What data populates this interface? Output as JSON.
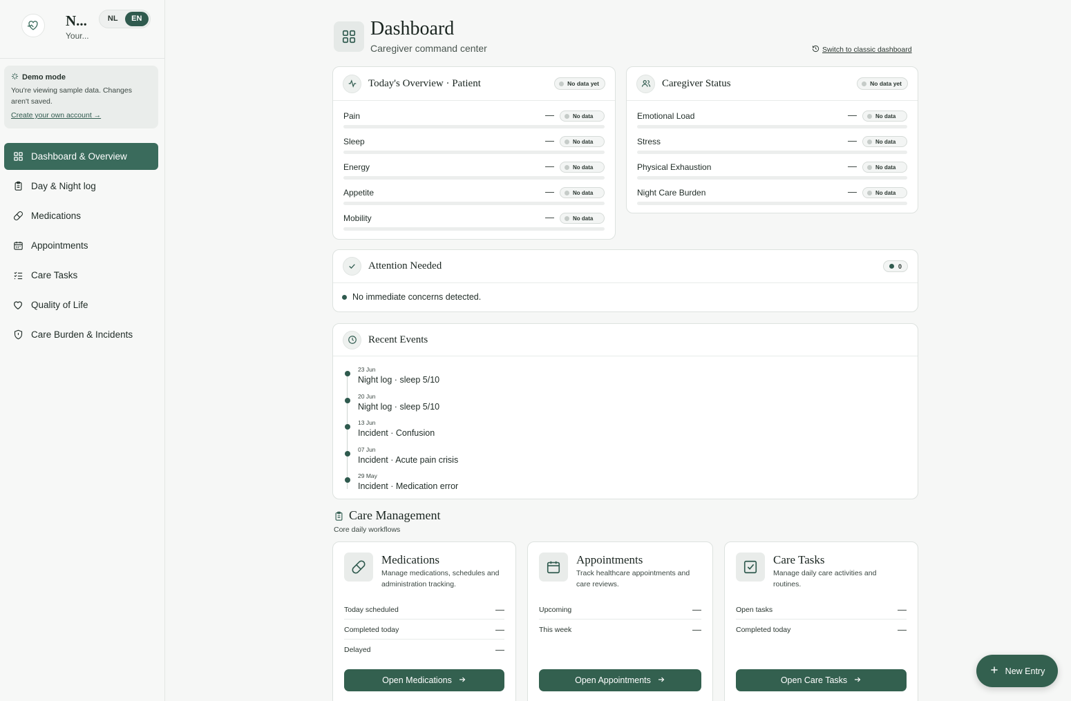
{
  "brand": {
    "title": "N...",
    "subtitle": "Your..."
  },
  "lang": {
    "nl": "NL",
    "en": "EN",
    "active": "EN"
  },
  "demo": {
    "title": "Demo mode",
    "text": "You're viewing sample data. Changes aren't saved.",
    "link": "Create your own account →"
  },
  "nav": [
    {
      "label": "Dashboard & Overview",
      "icon": "grid-icon",
      "active": true
    },
    {
      "label": "Day & Night log",
      "icon": "clipboard-icon"
    },
    {
      "label": "Medications",
      "icon": "pill-icon"
    },
    {
      "label": "Appointments",
      "icon": "calendar-icon"
    },
    {
      "label": "Care Tasks",
      "icon": "checklist-icon"
    },
    {
      "label": "Quality of Life",
      "icon": "heart-icon"
    },
    {
      "label": "Care Burden & Incidents",
      "icon": "shield-icon"
    }
  ],
  "header": {
    "title": "Dashboard",
    "subtitle": "Caregiver command center",
    "switch_link": "Switch to classic dashboard"
  },
  "overview": {
    "title": "Today's Overview · Patient",
    "badge": "No data yet",
    "metrics": [
      {
        "label": "Pain",
        "value": "—",
        "status": "No data"
      },
      {
        "label": "Sleep",
        "value": "—",
        "status": "No data"
      },
      {
        "label": "Energy",
        "value": "—",
        "status": "No data"
      },
      {
        "label": "Appetite",
        "value": "—",
        "status": "No data"
      },
      {
        "label": "Mobility",
        "value": "—",
        "status": "No data"
      }
    ]
  },
  "caregiver": {
    "title": "Caregiver Status",
    "badge": "No data yet",
    "metrics": [
      {
        "label": "Emotional Load",
        "value": "—",
        "status": "No data"
      },
      {
        "label": "Stress",
        "value": "—",
        "status": "No data"
      },
      {
        "label": "Physical Exhaustion",
        "value": "—",
        "status": "No data"
      },
      {
        "label": "Night Care Burden",
        "value": "—",
        "status": "No data"
      }
    ]
  },
  "attention": {
    "title": "Attention Needed",
    "count": "0",
    "message": "No immediate concerns detected."
  },
  "recent": {
    "title": "Recent Events",
    "events": [
      {
        "date": "23 Jun",
        "text": "Night log · sleep 5/10"
      },
      {
        "date": "20 Jun",
        "text": "Night log · sleep 5/10"
      },
      {
        "date": "13 Jun",
        "text": "Incident · Confusion"
      },
      {
        "date": "07 Jun",
        "text": "Incident · Acute pain crisis"
      },
      {
        "date": "29 May",
        "text": "Incident · Medication error"
      }
    ]
  },
  "care_management": {
    "title": "Care Management",
    "subtitle": "Core daily workflows",
    "cards": [
      {
        "title": "Medications",
        "desc": "Manage medications, schedules and administration tracking.",
        "stats": [
          {
            "label": "Today scheduled",
            "value": "—"
          },
          {
            "label": "Completed today",
            "value": "—"
          },
          {
            "label": "Delayed",
            "value": "—"
          }
        ],
        "button": "Open Medications"
      },
      {
        "title": "Appointments",
        "desc": "Track healthcare appointments and care reviews.",
        "stats": [
          {
            "label": "Upcoming",
            "value": "—"
          },
          {
            "label": "This week",
            "value": "—"
          }
        ],
        "button": "Open Appointments"
      },
      {
        "title": "Care Tasks",
        "desc": "Manage daily care activities and routines.",
        "stats": [
          {
            "label": "Open tasks",
            "value": "—"
          },
          {
            "label": "Completed today",
            "value": "—"
          }
        ],
        "button": "Open Care Tasks"
      }
    ]
  },
  "fab": {
    "label": "New Entry"
  },
  "colors": {
    "accent": "#3a6b5c",
    "button": "#33604f",
    "background": "#f6f7f6"
  }
}
